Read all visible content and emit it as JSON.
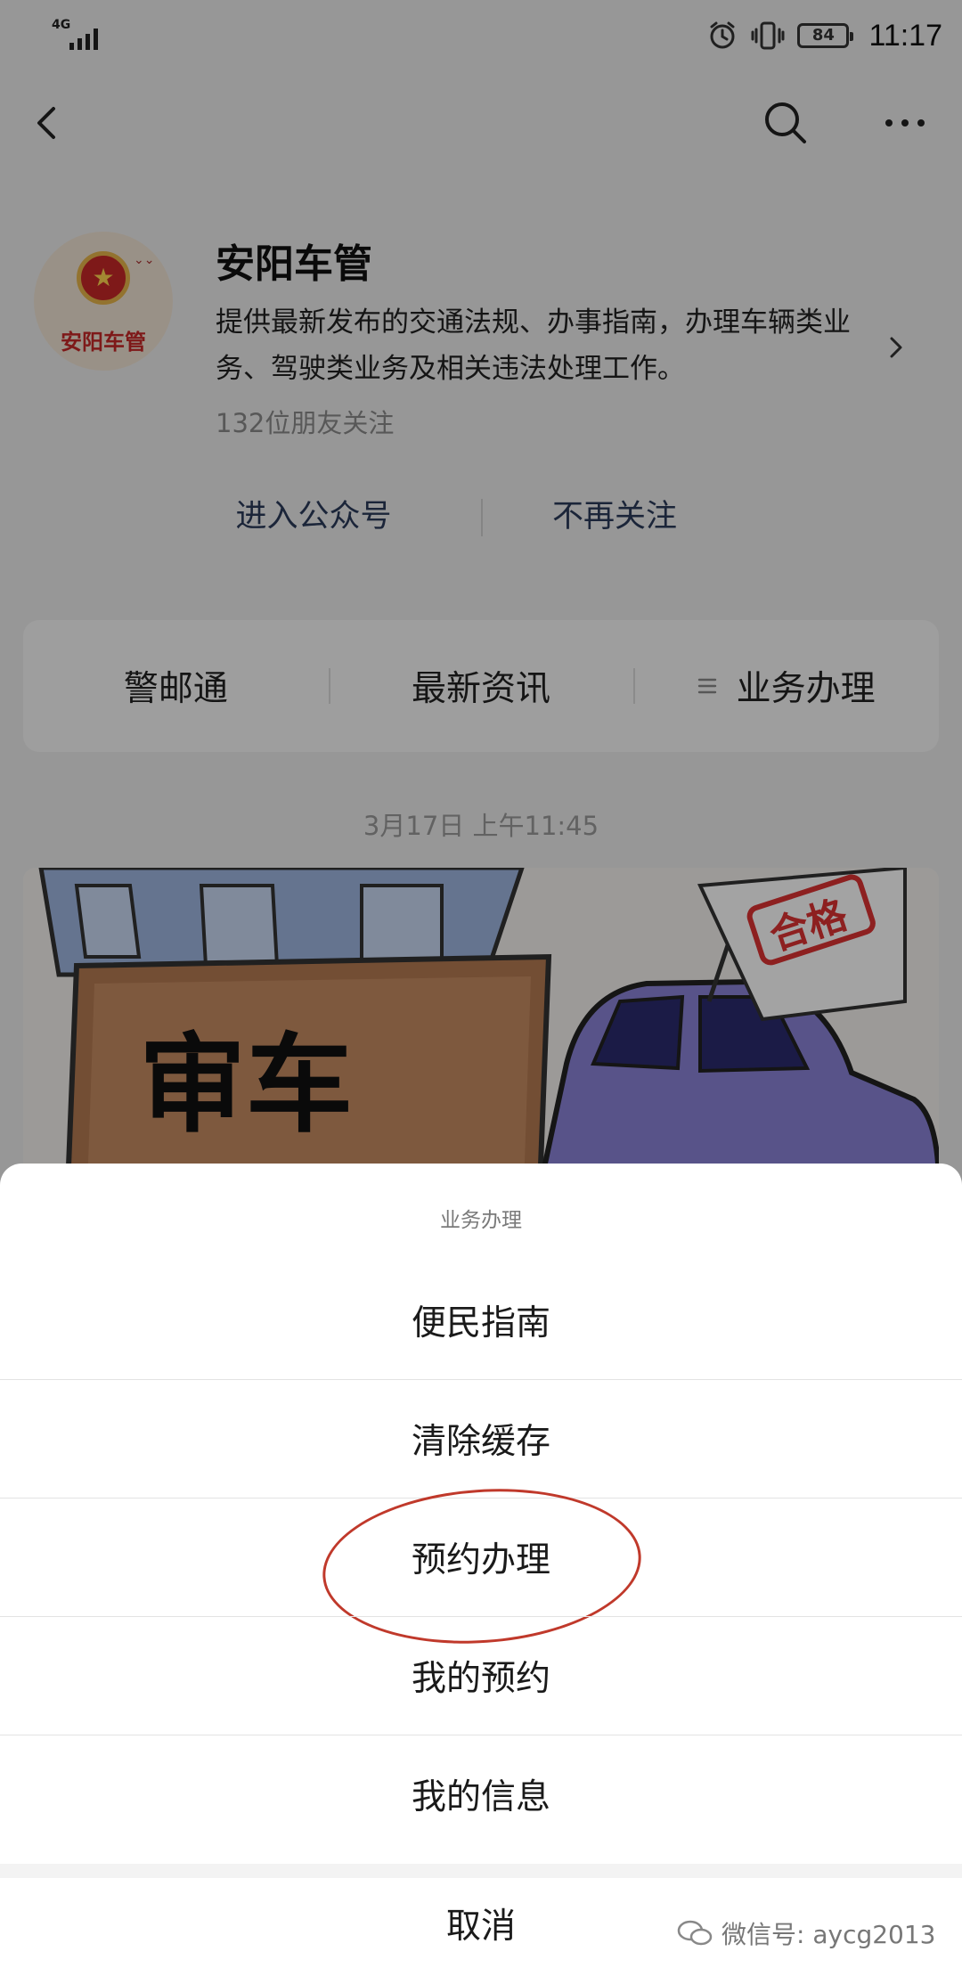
{
  "statusbar": {
    "network": "4G",
    "battery": "84",
    "time": "11:17"
  },
  "nav": {
    "back_icon": "chevron-left",
    "search_icon": "search",
    "more_icon": "ellipsis"
  },
  "account": {
    "avatar_text": "安阳车管",
    "name": "安阳车管",
    "description": "提供最新发布的交通法规、办事指南，办理车辆类业务、驾驶类业务及相关违法处理工作。",
    "followers": "132位朋友关注",
    "enter_label": "进入公众号",
    "unfollow_label": "不再关注"
  },
  "menu": {
    "tabs": [
      {
        "label": "警邮通"
      },
      {
        "label": "最新资讯"
      },
      {
        "label": "业务办理"
      }
    ]
  },
  "feed": {
    "timestamp": "3月17日 上午11:45",
    "image_text": "审车",
    "stamp_text": "合格"
  },
  "sheet": {
    "title": "业务办理",
    "items": [
      {
        "label": "便民指南"
      },
      {
        "label": "清除缓存"
      },
      {
        "label": "预约办理"
      },
      {
        "label": "我的预约"
      },
      {
        "label": "我的信息"
      }
    ],
    "cancel": "取消"
  },
  "watermark": "微信号: aycg2013",
  "colors": {
    "overlay": "#5c5c5c",
    "link_text": "#2b3a5a",
    "highlight_ring": "#c0392b"
  }
}
